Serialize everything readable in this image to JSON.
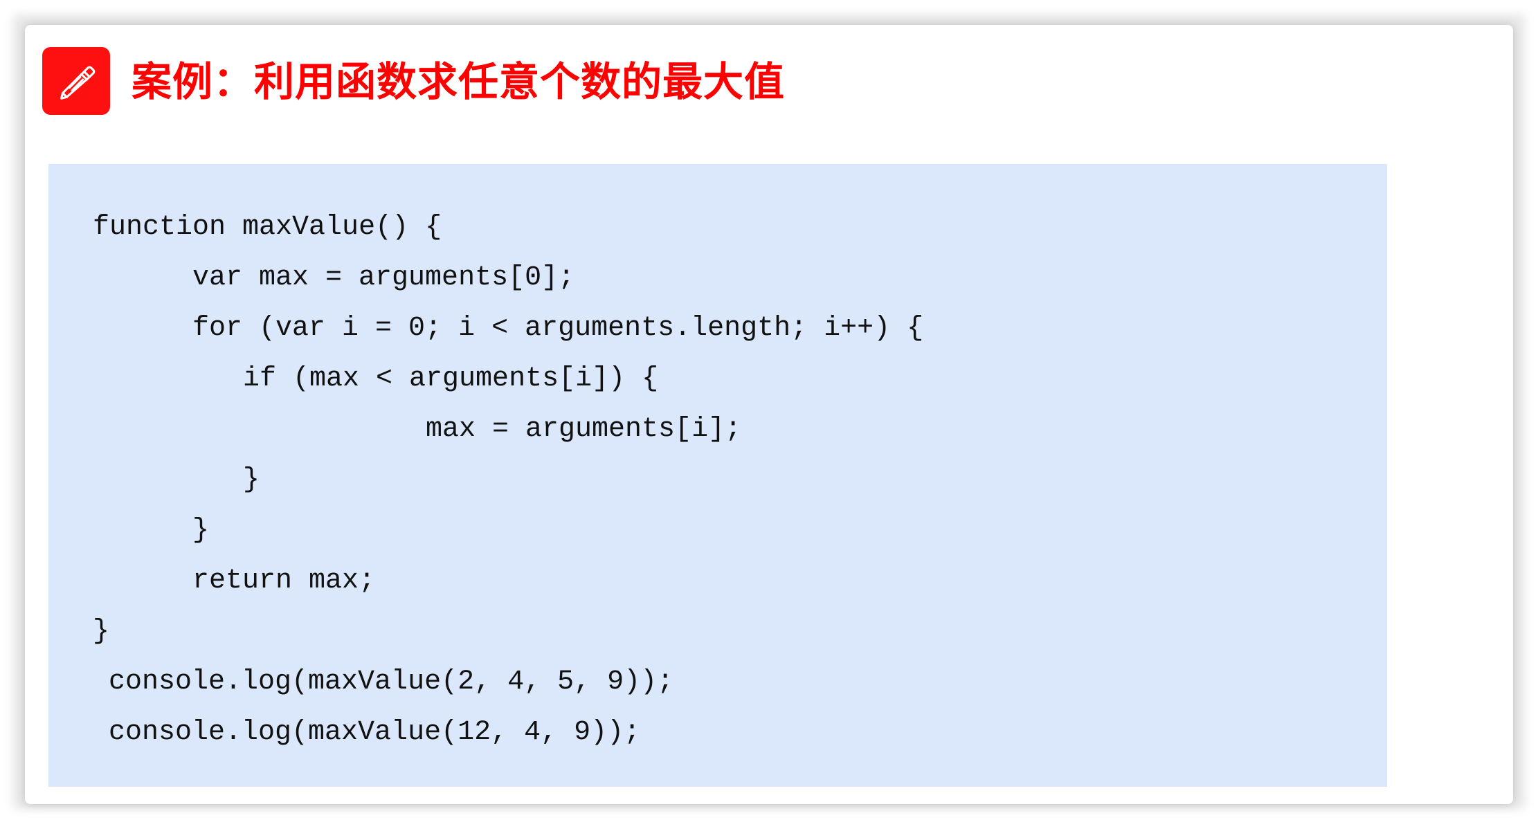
{
  "title": {
    "text": "案例：利用函数求任意个数的最大值",
    "color": "#ff0000",
    "icon": "pencil-icon"
  },
  "code": {
    "lines": [
      "function maxValue() {",
      "var max = arguments[0];",
      "for (var i = 0; i < arguments.length; i++) {",
      "if (max < arguments[i]) {",
      "max = arguments[i];",
      "}",
      "}",
      "return max;",
      "}",
      "console.log(maxValue(2, 4, 5, 9));",
      "console.log(maxValue(12, 4, 9));"
    ],
    "background": "#dbe8fc"
  }
}
